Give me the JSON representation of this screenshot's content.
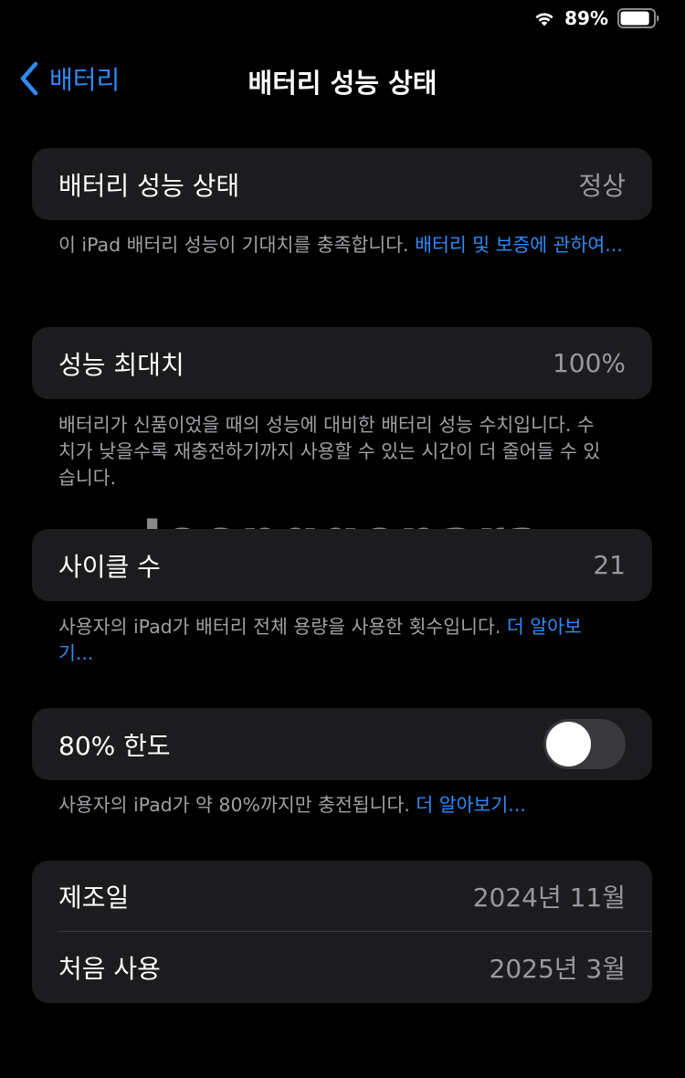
{
  "status_bar": {
    "battery_percent": "89%",
    "battery_level": 0.89
  },
  "nav": {
    "back_label": "배터리",
    "title": "배터리 성능 상태"
  },
  "health": {
    "label": "배터리 성능 상태",
    "value": "정상",
    "footnote_text": "이 iPad 배터리 성능이 기대치를 충족합니다. ",
    "footnote_link": "배터리 및 보증에 관하여..."
  },
  "max_capacity": {
    "label": "성능 최대치",
    "value": "100%",
    "footnote_text": "배터리가 신품이었을 때의 성능에 대비한 배터리 성능 수치입니다. 수치가 낮을수록 재충전하기까지 사용할 수 있는 시간이 더 줄어들 수 있습니다."
  },
  "cycle_count": {
    "label": "사이클 수",
    "value": "21",
    "footnote_text": "사용자의 iPad가 배터리 전체 용량을 사용한 횟수입니다. ",
    "footnote_link": "더 알아보기..."
  },
  "limit_80": {
    "label": "80% 한도",
    "toggle_on": false,
    "footnote_text": "사용자의 iPad가 약 80%까지만 충전됩니다. ",
    "footnote_link": "더 알아보기..."
  },
  "dates": {
    "manufacture_label": "제조일",
    "manufacture_value": "2024년 11월",
    "first_use_label": "처음 사용",
    "first_use_value": "2025년 3월"
  },
  "watermark": "Joonggonara",
  "colors": {
    "background": "#000000",
    "card": "#1c1c1e",
    "accent": "#2f8bf5",
    "secondary_text": "#98989f",
    "toggle_off": "#39393d"
  }
}
